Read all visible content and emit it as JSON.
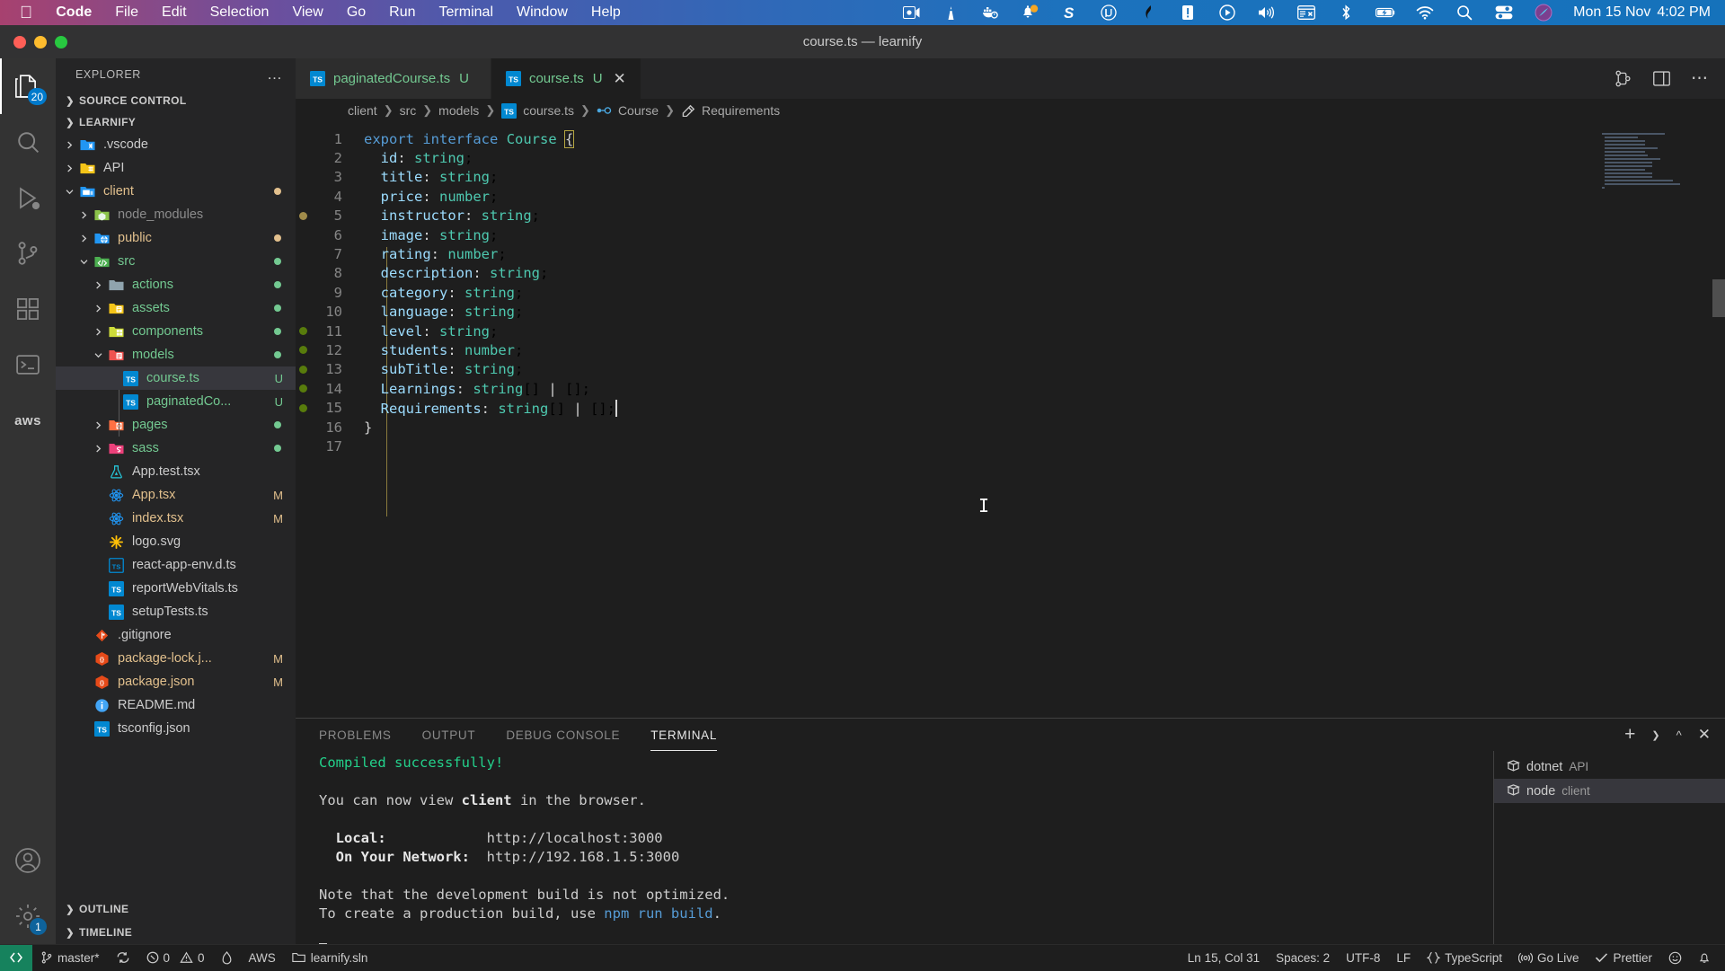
{
  "macos": {
    "apple_icon": "apple-logo-icon",
    "menus": [
      {
        "label": "Code",
        "bold": true
      },
      {
        "label": "File",
        "bold": false
      },
      {
        "label": "Edit",
        "bold": false
      },
      {
        "label": "Selection",
        "bold": false
      },
      {
        "label": "View",
        "bold": false
      },
      {
        "label": "Go",
        "bold": false
      },
      {
        "label": "Run",
        "bold": false
      },
      {
        "label": "Terminal",
        "bold": false
      },
      {
        "label": "Window",
        "bold": false
      },
      {
        "label": "Help",
        "bold": false
      }
    ],
    "tray_icons": [
      "screen-record-icon",
      "vlc-cone-icon",
      "docker-whale-icon",
      "notification-bell-icon",
      "sublime-s-icon",
      "utorrent-icon",
      "flag-black-icon",
      "alert-exclamation-icon",
      "play-circle-icon",
      "volume-speaker-icon",
      "window-manager-icon",
      "bluetooth-icon",
      "battery-charging-icon",
      "wifi-icon",
      "spotlight-search-icon",
      "control-center-icon",
      "siri-icon"
    ],
    "clock_date": "Mon 15 Nov",
    "clock_time": "4:02 PM"
  },
  "window": {
    "title": "course.ts — learnify",
    "traffic_lights": [
      "close-button",
      "minimize-button",
      "maximize-button"
    ]
  },
  "activitybar": {
    "items": [
      {
        "name": "explorer",
        "icon": "files-explorer-icon",
        "active": true,
        "badge": "20"
      },
      {
        "name": "search",
        "icon": "search-icon",
        "active": false,
        "badge": ""
      },
      {
        "name": "run-and-debug",
        "icon": "run-debug-icon",
        "active": false,
        "badge": ""
      },
      {
        "name": "source-control",
        "icon": "source-control-branch-icon",
        "active": false,
        "badge": ""
      },
      {
        "name": "extensions",
        "icon": "extensions-blocks-icon",
        "active": false,
        "badge": ""
      },
      {
        "name": "remote-explorer",
        "icon": "remote-terminal-icon",
        "active": false,
        "badge": ""
      },
      {
        "name": "aws-toolkit",
        "icon": "aws-text-icon",
        "active": false,
        "badge": ""
      }
    ],
    "bottom": [
      {
        "name": "accounts",
        "icon": "account-person-icon",
        "badge": ""
      },
      {
        "name": "manage-settings",
        "icon": "gear-icon",
        "badge": "1"
      }
    ]
  },
  "sidebar": {
    "title": "EXPLORER",
    "more_actions": "…",
    "sections": [
      {
        "label": "SOURCE CONTROL",
        "expanded": false
      },
      {
        "label": "LEARNIFY",
        "expanded": true
      }
    ],
    "tree": [
      {
        "label": ".vscode",
        "indent": 1,
        "type": "folder",
        "icon": "folder-vscode-icon",
        "twisty": "chevron-right",
        "color": "white",
        "status": "",
        "dot": ""
      },
      {
        "label": "API",
        "indent": 1,
        "type": "folder",
        "icon": "folder-api-icon",
        "twisty": "chevron-right",
        "color": "white",
        "status": "",
        "dot": ""
      },
      {
        "label": "client",
        "indent": 1,
        "type": "folder",
        "icon": "folder-client-icon",
        "twisty": "chevron-down",
        "color": "orange",
        "status": "",
        "dot": "orange"
      },
      {
        "label": "node_modules",
        "indent": 2,
        "type": "folder",
        "icon": "folder-node-icon",
        "twisty": "chevron-right",
        "color": "gray",
        "status": "",
        "dot": ""
      },
      {
        "label": "public",
        "indent": 2,
        "type": "folder",
        "icon": "folder-public-icon",
        "twisty": "chevron-right",
        "color": "orange",
        "status": "",
        "dot": "orange"
      },
      {
        "label": "src",
        "indent": 2,
        "type": "folder",
        "icon": "folder-src-icon",
        "twisty": "chevron-down",
        "color": "green",
        "status": "",
        "dot": "green"
      },
      {
        "label": "actions",
        "indent": 3,
        "type": "folder",
        "icon": "folder-plain-icon",
        "twisty": "chevron-right",
        "color": "green",
        "status": "",
        "dot": "green"
      },
      {
        "label": "assets",
        "indent": 3,
        "type": "folder",
        "icon": "folder-assets-icon",
        "twisty": "chevron-right",
        "color": "green",
        "status": "",
        "dot": "green"
      },
      {
        "label": "components",
        "indent": 3,
        "type": "folder",
        "icon": "folder-components-icon",
        "twisty": "chevron-right",
        "color": "green",
        "status": "",
        "dot": "green"
      },
      {
        "label": "models",
        "indent": 3,
        "type": "folder",
        "icon": "folder-models-icon",
        "twisty": "chevron-down",
        "color": "green",
        "status": "",
        "dot": "green"
      },
      {
        "label": "course.ts",
        "indent": 4,
        "type": "file",
        "icon": "typescript-file-icon",
        "twisty": "",
        "color": "green",
        "status": "U",
        "dot": "",
        "selected": true
      },
      {
        "label": "paginatedCo...",
        "indent": 4,
        "type": "file",
        "icon": "typescript-file-icon",
        "twisty": "",
        "color": "green",
        "status": "U",
        "dot": ""
      },
      {
        "label": "pages",
        "indent": 3,
        "type": "folder",
        "icon": "folder-pages-icon",
        "twisty": "chevron-right",
        "color": "green",
        "status": "",
        "dot": "green"
      },
      {
        "label": "sass",
        "indent": 3,
        "type": "folder",
        "icon": "folder-sass-icon",
        "twisty": "chevron-right",
        "color": "green",
        "status": "",
        "dot": "green"
      },
      {
        "label": "App.test.tsx",
        "indent": 3,
        "type": "file",
        "icon": "test-flask-icon",
        "twisty": "",
        "color": "white",
        "status": "",
        "dot": ""
      },
      {
        "label": "App.tsx",
        "indent": 3,
        "type": "file",
        "icon": "react-atom-icon",
        "twisty": "",
        "color": "orange",
        "status": "M",
        "dot": ""
      },
      {
        "label": "index.tsx",
        "indent": 3,
        "type": "file",
        "icon": "react-atom-icon",
        "twisty": "",
        "color": "orange",
        "status": "M",
        "dot": ""
      },
      {
        "label": "logo.svg",
        "indent": 3,
        "type": "file",
        "icon": "svg-star-icon",
        "twisty": "",
        "color": "white",
        "status": "",
        "dot": ""
      },
      {
        "label": "react-app-env.d.ts",
        "indent": 3,
        "type": "file",
        "icon": "typescript-def-file-icon",
        "twisty": "",
        "color": "white",
        "status": "",
        "dot": ""
      },
      {
        "label": "reportWebVitals.ts",
        "indent": 3,
        "type": "file",
        "icon": "typescript-file-icon",
        "twisty": "",
        "color": "white",
        "status": "",
        "dot": ""
      },
      {
        "label": "setupTests.ts",
        "indent": 3,
        "type": "file",
        "icon": "typescript-file-icon",
        "twisty": "",
        "color": "white",
        "status": "",
        "dot": ""
      },
      {
        "label": ".gitignore",
        "indent": 2,
        "type": "file",
        "icon": "git-file-icon",
        "twisty": "",
        "color": "white",
        "status": "",
        "dot": ""
      },
      {
        "label": "package-lock.j...",
        "indent": 2,
        "type": "file",
        "icon": "json-npm-icon",
        "twisty": "",
        "color": "orange",
        "status": "M",
        "dot": ""
      },
      {
        "label": "package.json",
        "indent": 2,
        "type": "file",
        "icon": "json-npm-icon",
        "twisty": "",
        "color": "orange",
        "status": "M",
        "dot": ""
      },
      {
        "label": "README.md",
        "indent": 2,
        "type": "file",
        "icon": "markdown-info-icon",
        "twisty": "",
        "color": "white",
        "status": "",
        "dot": ""
      },
      {
        "label": "tsconfig.json",
        "indent": 2,
        "type": "file",
        "icon": "tsconfig-icon",
        "twisty": "",
        "color": "white",
        "status": "",
        "dot": ""
      }
    ],
    "bottom_sections": [
      {
        "label": "OUTLINE",
        "expanded": false
      },
      {
        "label": "TIMELINE",
        "expanded": false
      }
    ]
  },
  "editor": {
    "tabs": [
      {
        "label": "paginatedCourse.ts",
        "icon": "typescript-file-icon",
        "status": "U",
        "active": false,
        "closable": false
      },
      {
        "label": "course.ts",
        "icon": "typescript-file-icon",
        "status": "U",
        "active": true,
        "closable": true,
        "close_icon": "close-icon"
      }
    ],
    "tab_actions": [
      "split-editor-icon",
      "layout-panel-icon",
      "more-actions-icon"
    ],
    "breadcrumbs": [
      {
        "label": "client",
        "icon": ""
      },
      {
        "label": "src",
        "icon": ""
      },
      {
        "label": "models",
        "icon": ""
      },
      {
        "label": "course.ts",
        "icon": "typescript-file-icon"
      },
      {
        "label": "Course",
        "icon": "interface-symbol-icon"
      },
      {
        "label": "Requirements",
        "icon": "property-symbol-icon"
      }
    ],
    "lines": [
      {
        "n": 1,
        "text": "export interface Course {",
        "gutter": ""
      },
      {
        "n": 2,
        "text": "  id: string;",
        "gutter": ""
      },
      {
        "n": 3,
        "text": "  title: string;",
        "gutter": ""
      },
      {
        "n": 4,
        "text": "  price: number;",
        "gutter": ""
      },
      {
        "n": 5,
        "text": "  instructor: string;",
        "gutter": "orange"
      },
      {
        "n": 6,
        "text": "  image: string;",
        "gutter": ""
      },
      {
        "n": 7,
        "text": "  rating: number;",
        "gutter": ""
      },
      {
        "n": 8,
        "text": "  description: string;",
        "gutter": ""
      },
      {
        "n": 9,
        "text": "  category: string;",
        "gutter": ""
      },
      {
        "n": 10,
        "text": "  language: string;",
        "gutter": ""
      },
      {
        "n": 11,
        "text": "  level: string;",
        "gutter": "green"
      },
      {
        "n": 12,
        "text": "  students: number;",
        "gutter": "green"
      },
      {
        "n": 13,
        "text": "  subTitle: string;",
        "gutter": "green"
      },
      {
        "n": 14,
        "text": "  Learnings: string[] | [];",
        "gutter": "green"
      },
      {
        "n": 15,
        "text": "  Requirements: string[] | [];",
        "gutter": "green"
      },
      {
        "n": 16,
        "text": "}",
        "gutter": ""
      },
      {
        "n": 17,
        "text": "",
        "gutter": ""
      }
    ]
  },
  "panel": {
    "tabs": [
      {
        "label": "PROBLEMS",
        "active": false
      },
      {
        "label": "OUTPUT",
        "active": false
      },
      {
        "label": "DEBUG CONSOLE",
        "active": false
      },
      {
        "label": "TERMINAL",
        "active": true
      }
    ],
    "actions": [
      "add-terminal-icon",
      "chevron-down-icon",
      "maximize-panel-icon",
      "close-panel-icon"
    ],
    "terminal_lines": [
      {
        "segments": [
          {
            "t": "Compiled successfully!",
            "c": "green"
          }
        ]
      },
      {
        "segments": [
          {
            "t": "",
            "c": "plain"
          }
        ]
      },
      {
        "segments": [
          {
            "t": "You can now view ",
            "c": "plain"
          },
          {
            "t": "client",
            "c": "bold"
          },
          {
            "t": " in the browser.",
            "c": "plain"
          }
        ]
      },
      {
        "segments": [
          {
            "t": "",
            "c": "plain"
          }
        ]
      },
      {
        "segments": [
          {
            "t": "  Local:            ",
            "c": "bold"
          },
          {
            "t": "http://localhost:3000",
            "c": "plain"
          }
        ]
      },
      {
        "segments": [
          {
            "t": "  On Your Network:  ",
            "c": "bold"
          },
          {
            "t": "http://192.168.1.5:3000",
            "c": "plain"
          }
        ]
      },
      {
        "segments": [
          {
            "t": "",
            "c": "plain"
          }
        ]
      },
      {
        "segments": [
          {
            "t": "Note that the development build is not optimized.",
            "c": "plain"
          }
        ]
      },
      {
        "segments": [
          {
            "t": "To create a production build, use ",
            "c": "plain"
          },
          {
            "t": "npm run build",
            "c": "blue"
          },
          {
            "t": ".",
            "c": "plain"
          }
        ]
      },
      {
        "segments": [
          {
            "t": "",
            "c": "plain"
          }
        ]
      },
      {
        "segments": [
          {
            "t": "CURSORBLOCK",
            "c": "cursor"
          }
        ]
      }
    ],
    "terminal_list": [
      {
        "name": "dotnet",
        "sub": "API",
        "icon": "terminal-shell-icon",
        "selected": false
      },
      {
        "name": "node",
        "sub": "client",
        "icon": "terminal-shell-icon",
        "selected": true
      }
    ]
  },
  "statusbar": {
    "remote_icon": "remote-window-icon",
    "branch_icon": "source-control-branch-icon",
    "branch": "master*",
    "sync_icon": "sync-refresh-icon",
    "errors_icon": "error-circle-icon",
    "errors": "0",
    "warnings_icon": "warning-triangle-icon",
    "warnings": "0",
    "radon_icon": "flame-icon",
    "aws_label": "AWS",
    "solution_icon": "folder-open-icon",
    "solution": "learnify.sln",
    "cursor_position": "Ln 15, Col 31",
    "spaces": "Spaces: 2",
    "encoding": "UTF-8",
    "eol": "LF",
    "language_icon": "braces-icon",
    "language": "TypeScript",
    "golive_icon": "broadcast-icon",
    "golive": "Go Live",
    "prettier_icon": "check-icon",
    "prettier": "Prettier",
    "bell_icon": "bell-icon",
    "feedback_icon": "smiley-icon"
  },
  "colors": {
    "accent_blue": "#007acc",
    "editor_bg": "#1e1e1e",
    "sidebar_bg": "#252526",
    "activitybar_bg": "#333333",
    "green_status": "#73c991",
    "orange_status": "#e2c08d",
    "remote_green": "#16825d",
    "terminal_green": "#23d18b"
  }
}
